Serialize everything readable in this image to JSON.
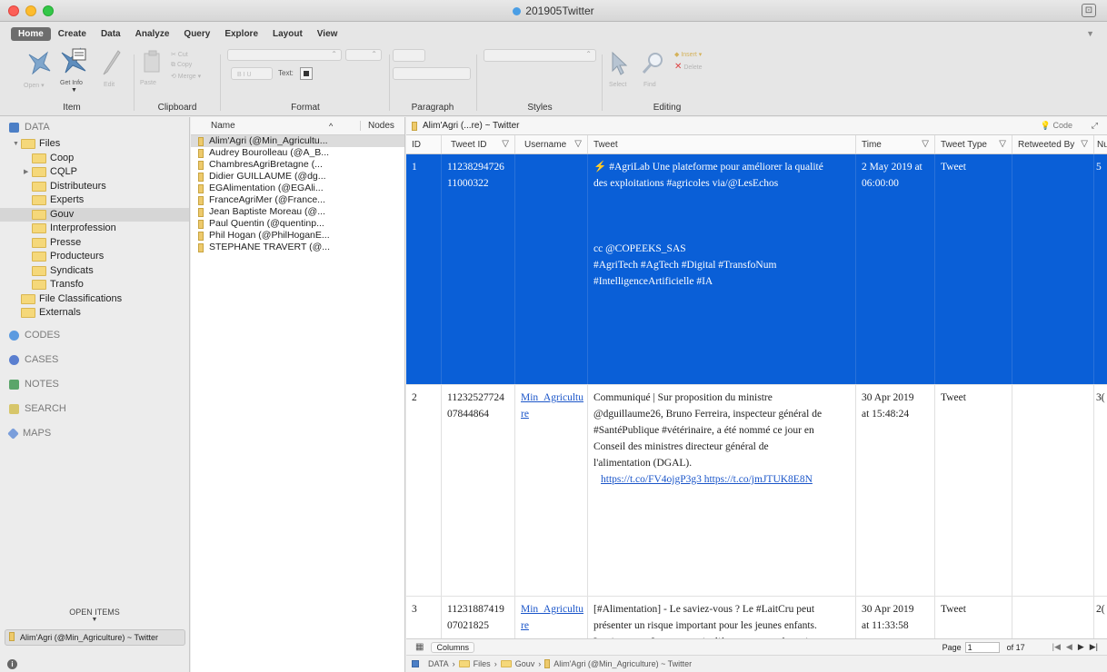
{
  "window": {
    "title": "201905Twitter"
  },
  "ribbon": {
    "tabs": [
      "Home",
      "Create",
      "Data",
      "Analyze",
      "Query",
      "Explore",
      "Layout",
      "View"
    ],
    "groups": [
      "Item",
      "Clipboard",
      "Format",
      "Paragraph",
      "Styles",
      "Editing"
    ],
    "get_info": "Get Info",
    "text_label": "Text:"
  },
  "sidebar": {
    "data_label": "DATA",
    "files_label": "Files",
    "folders": [
      "Coop",
      "CQLP",
      "Distributeurs",
      "Experts",
      "Gouv",
      "Interprofession",
      "Presse",
      "Producteurs",
      "Syndicats",
      "Transfo"
    ],
    "file_classifications": "File Classifications",
    "externals": "Externals",
    "sections": [
      "CODES",
      "CASES",
      "NOTES",
      "SEARCH",
      "MAPS"
    ],
    "open_items_label": "OPEN ITEMS",
    "open_item": "Alim'Agri (@Min_Agriculture) ~ Twitter"
  },
  "list": {
    "col_name": "Name",
    "col_nodes": "Nodes",
    "items": [
      "Alim'Agri (@Min_Agricultu...",
      "Audrey Bourolleau (@A_B...",
      "ChambresAgriBretagne (...",
      "Didier GUILLAUME (@dg...",
      "EGAlimentation (@EGAli...",
      "FranceAgriMer (@France...",
      "Jean Baptiste Moreau (@...",
      "Paul Quentin (@quentinp...",
      "Phil Hogan (@PhilHoganE...",
      "STEPHANE TRAVERT (@..."
    ]
  },
  "doc": {
    "tab_title": "Alim'Agri (...re) ~ Twitter",
    "code_label": "Code",
    "columns": [
      "ID",
      "Tweet ID",
      "Username",
      "Tweet",
      "Time",
      "Tweet Type",
      "Retweeted By",
      "Nu"
    ],
    "rows": [
      {
        "id": "1",
        "tweet_id_1": "11238294726",
        "tweet_id_2": "11000322",
        "username_1": "",
        "username_2": "",
        "tweet_lines": [
          "⚡ #AgriLab Une plateforme pour améliorer la qualité",
          "des exploitations #agricoles via/@LesEchos",
          "",
          "",
          "",
          "cc @COPEEKS_SAS",
          "#AgriTech #AgTech #Digital #TransfoNum",
          "#IntelligenceArtificielle #IA"
        ],
        "links": "",
        "time_1": "2 May 2019 at",
        "time_2": "06:00:00",
        "type": "Tweet",
        "num": "5"
      },
      {
        "id": "2",
        "tweet_id_1": "11232527724",
        "tweet_id_2": "07844864",
        "username_1": "Min_Agricultu",
        "username_2": "re",
        "tweet_lines": [
          "Communiqué  | Sur proposition du ministre",
          "@dguillaume26, Bruno Ferreira, inspecteur général de",
          "#SantéPublique #vétérinaire, a été nommé ce jour en",
          "Conseil des ministres directeur général de",
          "l'alimentation (DGAL)."
        ],
        "links": "https://t.co/FV4ojgP3g3 https://t.co/jmJTUK8E8N",
        "time_1": "30 Apr 2019",
        "time_2": "at 15:48:24",
        "type": "Tweet",
        "num": "3("
      },
      {
        "id": "3",
        "tweet_id_1": "11231887419",
        "tweet_id_2": "07021825",
        "username_1": "Min_Agricultu",
        "username_2": "re",
        "tweet_lines": [
          "[#Alimentation] - Le saviez-vous ? Le #LaitCru peut",
          "présenter un risque important pour les jeunes enfants.",
          "  Les jeunes enfants, et particulièrement ceux de moins"
        ],
        "links": "",
        "time_1": "30 Apr 2019",
        "time_2": "at 11:33:58",
        "type": "Tweet",
        "num": "2("
      }
    ],
    "columns_button": "Columns",
    "page_label": "Page",
    "page_value": "1",
    "page_of": "of 17"
  },
  "path": [
    "DATA",
    "Files",
    "Gouv",
    "Alim'Agri (@Min_Agriculture) ~ Twitter"
  ]
}
